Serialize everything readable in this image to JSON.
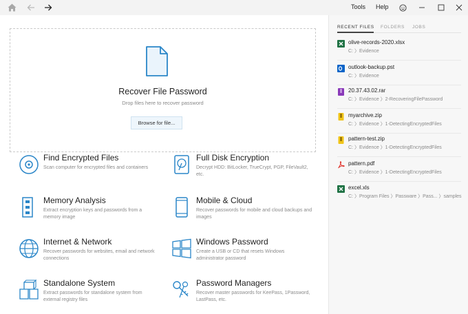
{
  "menu": {
    "tools": "Tools",
    "help": "Help"
  },
  "dropzone": {
    "title": "Recover File Password",
    "subtitle": "Drop files here to recover password",
    "browse_label": "Browse for file..."
  },
  "features": [
    {
      "title": "Find Encrypted Files",
      "desc": "Scan computer for encrypted files and containers",
      "icon": "disc-icon"
    },
    {
      "title": "Full Disk Encryption",
      "desc": "Decrypt HDD: BitLocker, TrueCrypt, PGP, FileVault2, etc.",
      "icon": "hard-drive-icon"
    },
    {
      "title": "Memory Analysis",
      "desc": "Extract encryption keys and passwords from a memory image",
      "icon": "memory-chip-icon"
    },
    {
      "title": "Mobile & Cloud",
      "desc": "Recover passwords for mobile and cloud backups and images",
      "icon": "mobile-phone-icon"
    },
    {
      "title": "Internet & Network",
      "desc": "Recover passwords for websites, email and network connections",
      "icon": "globe-icon"
    },
    {
      "title": "Windows Password",
      "desc": "Create a USB or CD that resets Windows administrator password",
      "icon": "windows-logo-icon"
    },
    {
      "title": "Standalone System",
      "desc": "Extract passwords for standalone system from external registry files",
      "icon": "cubes-icon"
    },
    {
      "title": "Password Managers",
      "desc": "Recover master passwords for KeePass, 1Password, LastPass, etc.",
      "icon": "keys-icon"
    }
  ],
  "sidebar": {
    "tabs": [
      "RECENT FILES",
      "FOLDERS",
      "JOBS"
    ],
    "recent": [
      {
        "name": "olive-records-2020.xlsx",
        "path": "C: 〉Evidence",
        "icon": "excel-icon",
        "color": "#1f7244"
      },
      {
        "name": "outlook-backup.pst",
        "path": "C: 〉Evidence",
        "icon": "outlook-icon",
        "color": "#0a64c8"
      },
      {
        "name": "20.37.43.02.rar",
        "path": "C: 〉Evidence 〉2-RecoveringFilePassword",
        "icon": "rar-archive-icon",
        "color": "#8a3ab9"
      },
      {
        "name": "myarchive.zip",
        "path": "C: 〉Evidence 〉1-DetectingEncryptedFiles",
        "icon": "zip-archive-icon",
        "color": "#f0c419"
      },
      {
        "name": "pattern-test.zip",
        "path": "C: 〉Evidence 〉1-DetectingEncryptedFiles",
        "icon": "zip-archive-icon",
        "color": "#f0c419"
      },
      {
        "name": "pattern.pdf",
        "path": "C: 〉Evidence 〉1-DetectingEncryptedFiles",
        "icon": "pdf-icon",
        "color": "#e0332b"
      },
      {
        "name": "excel.xls",
        "path": "C: 〉Program Files 〉Passware 〉Pass... 〉samples",
        "icon": "excel-icon",
        "color": "#1f7244"
      }
    ]
  },
  "colors": {
    "accent": "#2a86c8",
    "sidebar_bg": "#f7f7f7",
    "titlebar_bg": "#f3f3f3"
  }
}
